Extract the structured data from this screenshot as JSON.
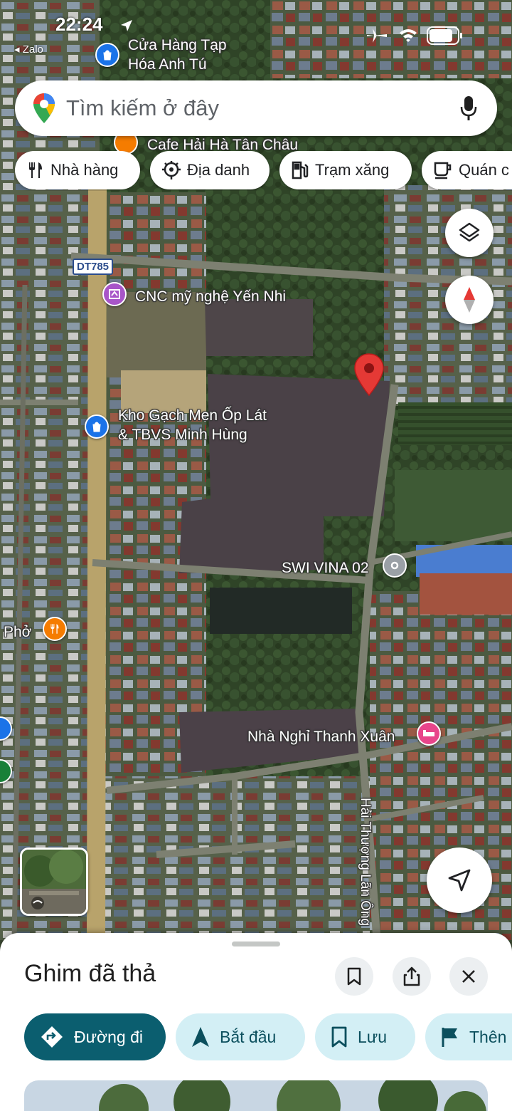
{
  "status_bar": {
    "time": "22:24",
    "back_app": "◂ Zalo"
  },
  "search": {
    "placeholder": "Tìm kiếm ở đây"
  },
  "chips": [
    {
      "label": "Nhà hàng",
      "icon": "fork-knife-icon"
    },
    {
      "label": "Địa danh",
      "icon": "landmark-icon"
    },
    {
      "label": "Trạm xăng",
      "icon": "gas-station-icon"
    },
    {
      "label": "Quán c",
      "icon": "coffee-icon"
    }
  ],
  "road_shield": "DT785",
  "map_labels": {
    "poi_1": "Cửa Hàng Tạp\nHóa Anh Tú",
    "poi_2": "Cafe Hải Hà Tân Châu",
    "poi_3": "CNC mỹ nghệ Yến Nhi",
    "poi_4": "Kho Gạch Men Ốp Lát\n& TBVS Minh Hùng",
    "poi_5": "SWI VINA 02",
    "poi_6": "Phở",
    "poi_7": "Nhà Nghỉ Thanh Xuân",
    "street": "Hải Thượng Lãn Ông"
  },
  "colors": {
    "accent": "#0b5e6f",
    "accent_light": "#d3eff5",
    "pin": "#e53935",
    "shop_poi": "#1a73e8",
    "food_poi": "#f57c00",
    "lodging_poi": "#e8458b",
    "place_poi": "#a855c8"
  },
  "sheet": {
    "title": "Ghim đã thả",
    "actions": [
      {
        "label": "Đường đi",
        "icon": "directions-icon"
      },
      {
        "label": "Bắt đầu",
        "icon": "navigation-arrow-icon"
      },
      {
        "label": "Lưu",
        "icon": "bookmark-icon"
      },
      {
        "label": "Thên",
        "icon": "flag-icon"
      }
    ]
  }
}
